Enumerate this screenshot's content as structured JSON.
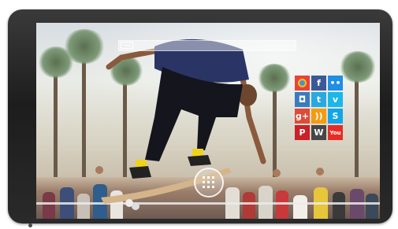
{
  "search": {
    "label": ""
  },
  "social_tiles": [
    {
      "name": "chrome",
      "icon": "chrome-icon",
      "glyph": "",
      "color": "#e8433a"
    },
    {
      "name": "facebook",
      "icon": "facebook-icon",
      "glyph": "f",
      "color": "#3b5998"
    },
    {
      "name": "flickr",
      "icon": "flickr-icon",
      "glyph": "••",
      "color": "#1f8ee6"
    },
    {
      "name": "instagram",
      "icon": "instagram-icon",
      "glyph": "◘",
      "color": "#3a7bbf"
    },
    {
      "name": "twitter",
      "icon": "twitter-icon",
      "glyph": "t",
      "color": "#2aa9e0"
    },
    {
      "name": "vimeo",
      "icon": "vimeo-icon",
      "glyph": "v",
      "color": "#1ab7ea"
    },
    {
      "name": "google-plus",
      "icon": "google-plus-icon",
      "glyph": "g+",
      "color": "#dd4b39"
    },
    {
      "name": "rss",
      "icon": "rss-icon",
      "glyph": "))",
      "color": "#f39c12"
    },
    {
      "name": "skype",
      "icon": "skype-icon",
      "glyph": "S",
      "color": "#12a5e8"
    },
    {
      "name": "pinterest",
      "icon": "pinterest-icon",
      "glyph": "P",
      "color": "#cb2027"
    },
    {
      "name": "wordpress",
      "icon": "wordpress-icon",
      "glyph": "W",
      "color": "#464646"
    },
    {
      "name": "youtube",
      "icon": "youtube-icon",
      "glyph": "You",
      "color": "#e52d27"
    }
  ],
  "apps_button": {
    "icon": "app-grid-icon"
  }
}
